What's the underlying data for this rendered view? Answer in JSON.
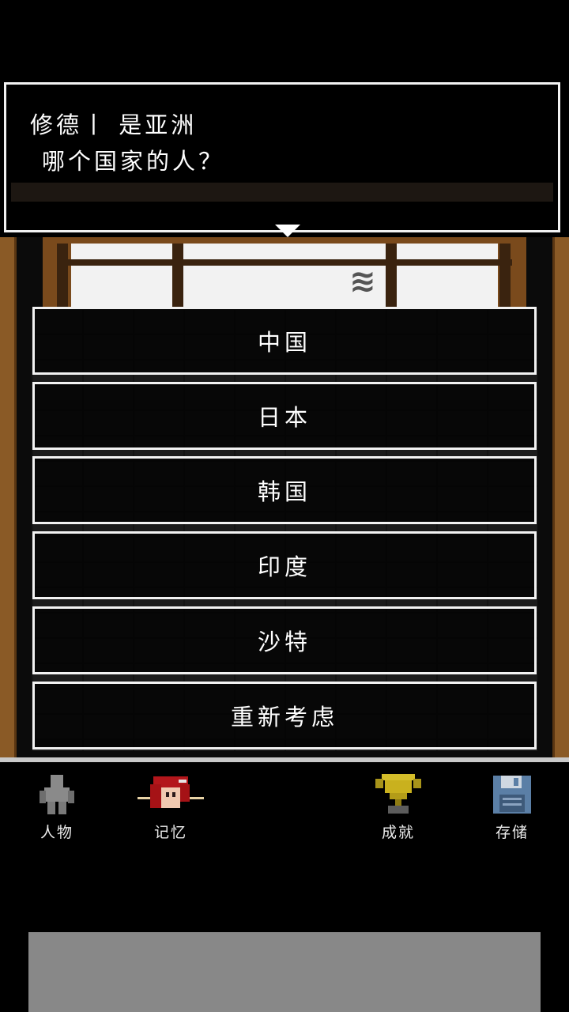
{
  "dialog": {
    "line1": "修德丨 是亚洲",
    "line2": "哪个国家的人？"
  },
  "choices": [
    {
      "label": "中国"
    },
    {
      "label": "日本"
    },
    {
      "label": "韩国"
    },
    {
      "label": "印度"
    },
    {
      "label": "沙特"
    },
    {
      "label": "重新考虑"
    }
  ],
  "bottom_nav": [
    {
      "label": "人物",
      "icon": "person-icon"
    },
    {
      "label": "记忆",
      "icon": "memory-portrait-icon"
    },
    {
      "label": "成就",
      "icon": "trophy-icon"
    },
    {
      "label": "存储",
      "icon": "floppy-disk-icon"
    }
  ],
  "colors": {
    "frame": "#f2f2f2",
    "wood": "#8a5a26",
    "trophy": "#c9b11e",
    "floppy": "#5b7fa6",
    "ad_placeholder": "#888888"
  }
}
